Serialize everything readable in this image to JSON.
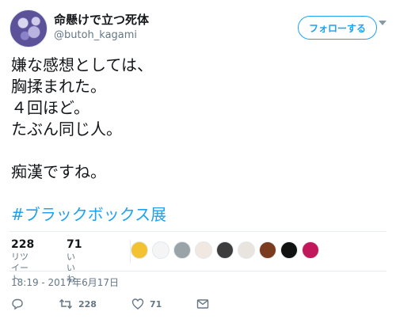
{
  "user": {
    "display_name": "命懸けで立つ死体",
    "handle": "@butoh_kagami"
  },
  "follow_button_label": "フォローする",
  "tweet": {
    "text": "嫌な感想としては、\n胸揉まれた。\n４回ほど。\nたぶん同じ人。\n\n痴漢ですね。",
    "hashtag": "#ブラックボックス展"
  },
  "stats": {
    "retweets": {
      "count": "228",
      "label": "リツイート"
    },
    "likes": {
      "count": "71",
      "label": "いいね"
    }
  },
  "likers": [
    {
      "icon": "liker-avatar",
      "color": "#f2c230"
    },
    {
      "icon": "liker-avatar",
      "color": "#f5f5f5"
    },
    {
      "icon": "liker-avatar",
      "color": "#9aa3a8"
    },
    {
      "icon": "liker-avatar",
      "color": "#f1e8e2"
    },
    {
      "icon": "liker-avatar",
      "color": "#3d3d3d"
    },
    {
      "icon": "liker-avatar",
      "color": "#e9e4de"
    },
    {
      "icon": "liker-avatar",
      "color": "#7a3b1e"
    },
    {
      "icon": "liker-avatar",
      "color": "#111111"
    },
    {
      "icon": "liker-avatar",
      "color": "#c2185b"
    }
  ],
  "timestamp": "18:19 - 2017年6月17日",
  "actions": {
    "reply_icon": "reply-icon",
    "retweet_icon": "retweet-icon",
    "retweet_count": "228",
    "like_icon": "heart-icon",
    "like_count": "71",
    "dm_icon": "envelope-icon"
  },
  "colors": {
    "accent": "#1da1f2",
    "text": "#14171a",
    "secondary": "#657786"
  }
}
